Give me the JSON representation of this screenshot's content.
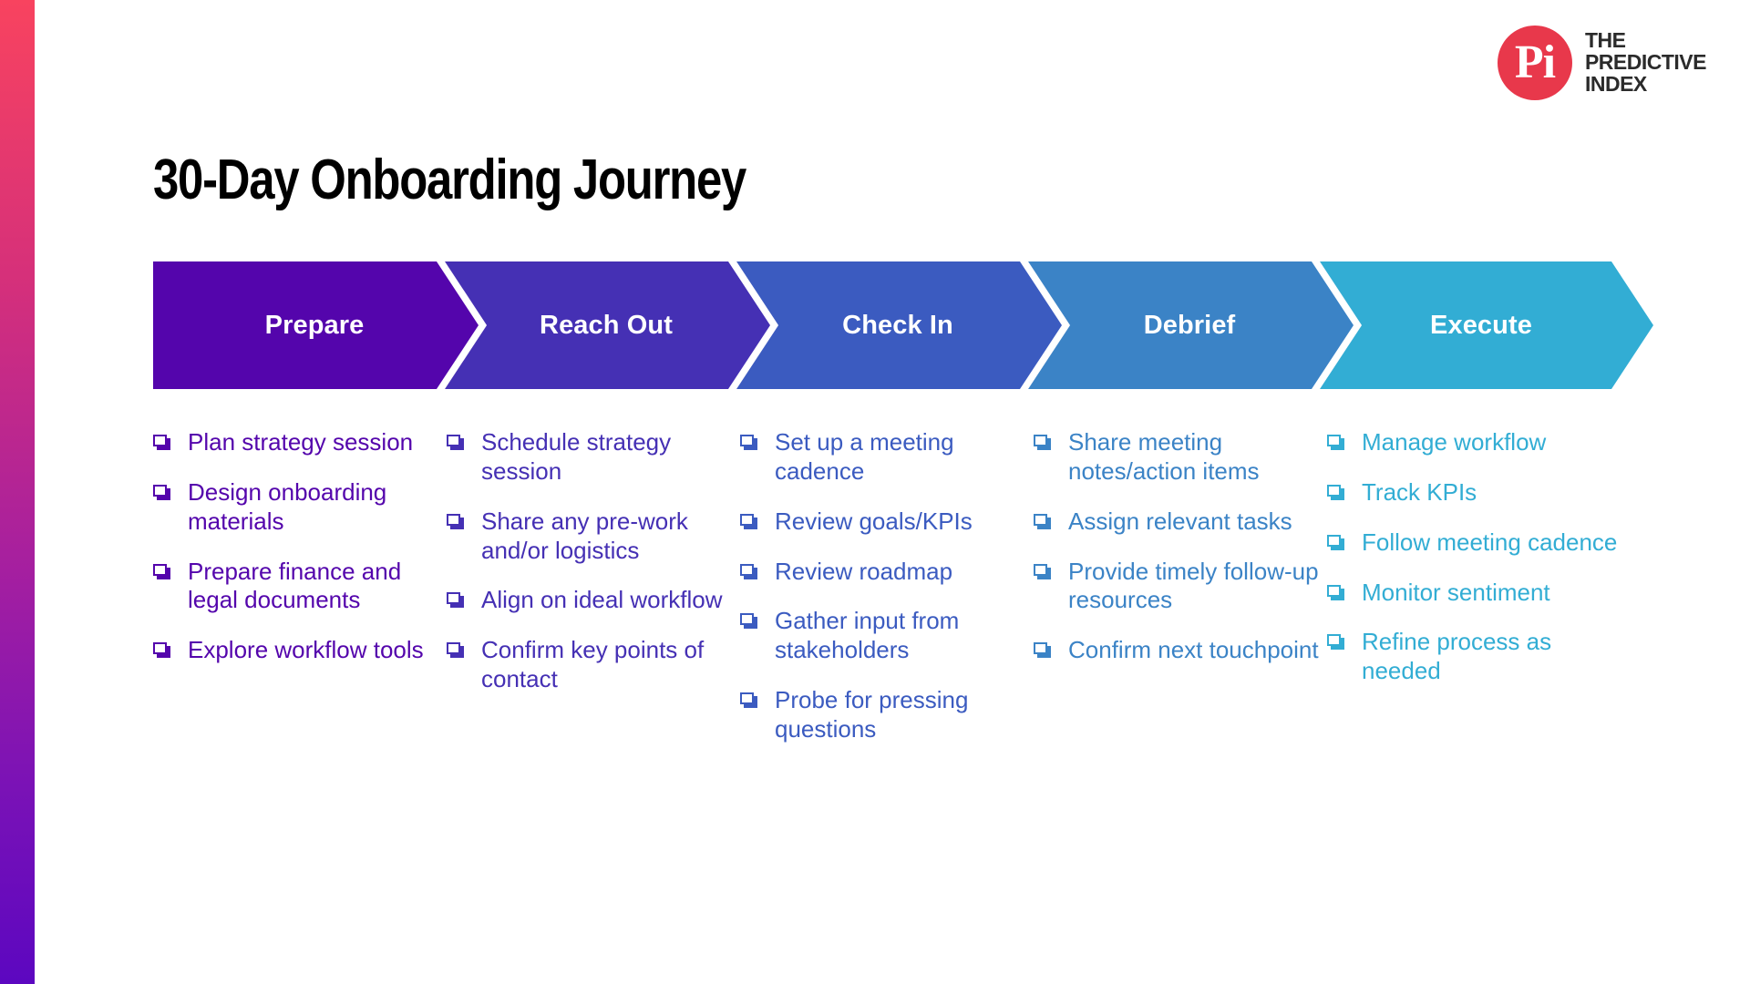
{
  "page": {
    "title": "30-Day Onboarding Journey",
    "background": "#ffffff",
    "accent_bar": {
      "gradient_from": "#F8435F",
      "gradient_to": "#5C07C0"
    }
  },
  "logo": {
    "mark_text": "Pi",
    "mark_color": "#E8384B",
    "wordmark_line1": "THE",
    "wordmark_line2": "PREDICTIVE",
    "wordmark_line3": "INDEX",
    "wordmark_color": "#2B2B2B"
  },
  "stages": [
    {
      "label": "Prepare",
      "color": "#5405AC",
      "items": [
        "Plan strategy session",
        "Design onboarding materials",
        "Prepare finance and legal documents",
        "Explore workflow tools"
      ]
    },
    {
      "label": "Reach Out",
      "color": "#4530B4",
      "items": [
        "Schedule strategy session",
        "Share any pre-work and/or logistics",
        "Align on ideal workflow",
        "Confirm key points of contact"
      ]
    },
    {
      "label": "Check In",
      "color": "#3B5BC0",
      "items": [
        "Set up a meeting cadence",
        "Review goals/KPIs",
        "Review roadmap",
        "Gather input from stakeholders",
        "Probe for pressing questions"
      ]
    },
    {
      "label": "Debrief",
      "color": "#3B83C6",
      "items": [
        "Share meeting notes/action items",
        "Assign relevant tasks",
        "Provide timely follow-up resources",
        "Confirm next touchpoint"
      ]
    },
    {
      "label": "Execute",
      "color": "#32ADD4",
      "items": [
        "Manage workflow",
        "Track KPIs",
        "Follow meeting cadence",
        "Monitor sentiment",
        "Refine process as needed"
      ]
    }
  ]
}
